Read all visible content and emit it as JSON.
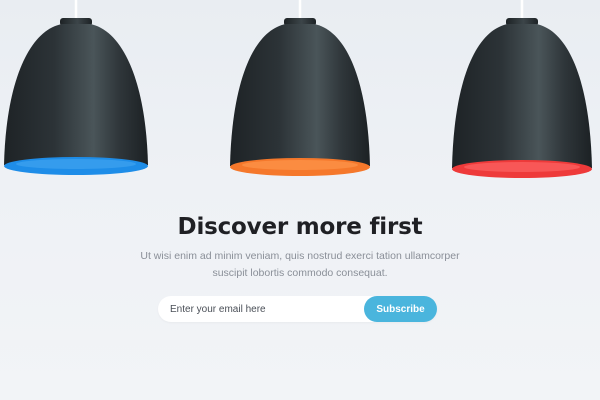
{
  "hero": {
    "title": "Discover more first",
    "subtitle": "Ut wisi enim ad minim veniam, quis nostrud exerci tation ullamcorper suscipit lobortis commodo consequat."
  },
  "signup": {
    "email_placeholder": "Enter your email here",
    "subscribe_label": "Subscribe"
  },
  "lamps": [
    {
      "name": "lamp-blue",
      "glow_color": "#1e8de8"
    },
    {
      "name": "lamp-orange",
      "glow_color": "#f5782b"
    },
    {
      "name": "lamp-red",
      "glow_color": "#ee3a3a"
    }
  ],
  "colors": {
    "accent": "#4ab5dd",
    "title": "#1f2024",
    "body_text": "#8a8f98",
    "background": "#eef1f5"
  }
}
